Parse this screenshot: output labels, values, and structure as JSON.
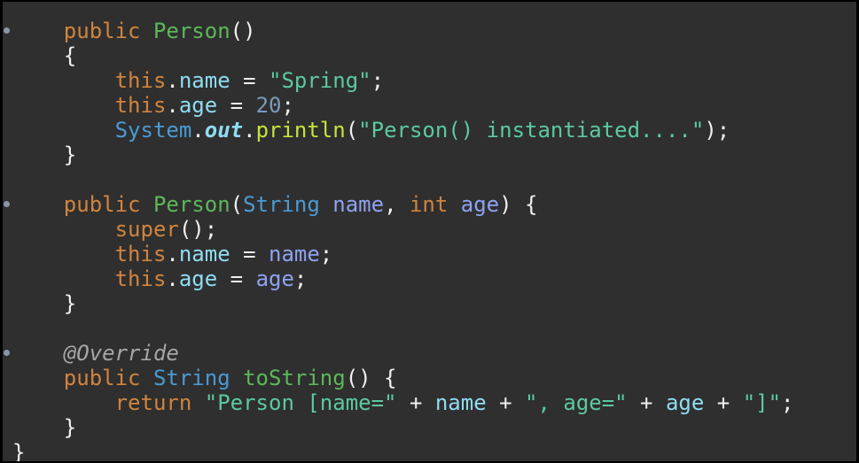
{
  "code": {
    "lines": [
      {
        "fold": true,
        "tokens": [
          [
            "    ",
            "plain"
          ],
          [
            "public",
            "kw"
          ],
          [
            " ",
            "plain"
          ],
          [
            "Person",
            "type"
          ],
          [
            "()",
            "plain"
          ]
        ]
      },
      {
        "tokens": [
          [
            "    {",
            "plain"
          ]
        ]
      },
      {
        "tokens": [
          [
            "        ",
            "plain"
          ],
          [
            "this",
            "kw"
          ],
          [
            ".",
            "plain"
          ],
          [
            "name",
            "field"
          ],
          [
            " = ",
            "plain"
          ],
          [
            "\"Spring\"",
            "str"
          ],
          [
            ";",
            "plain"
          ]
        ]
      },
      {
        "tokens": [
          [
            "        ",
            "plain"
          ],
          [
            "this",
            "kw"
          ],
          [
            ".",
            "plain"
          ],
          [
            "age",
            "field"
          ],
          [
            " = ",
            "plain"
          ],
          [
            "20",
            "num"
          ],
          [
            ";",
            "plain"
          ]
        ]
      },
      {
        "tokens": [
          [
            "        ",
            "plain"
          ],
          [
            "System",
            "cls"
          ],
          [
            ".",
            "plain"
          ],
          [
            "out",
            "static"
          ],
          [
            ".",
            "plain"
          ],
          [
            "println",
            "method"
          ],
          [
            "(",
            "plain"
          ],
          [
            "\"Person() instantiated....\"",
            "str"
          ],
          [
            ");",
            "plain"
          ]
        ]
      },
      {
        "tokens": [
          [
            "    }",
            "plain"
          ]
        ]
      },
      {
        "tokens": []
      },
      {
        "fold": true,
        "tokens": [
          [
            "    ",
            "plain"
          ],
          [
            "public",
            "kw"
          ],
          [
            " ",
            "plain"
          ],
          [
            "Person",
            "type"
          ],
          [
            "(",
            "plain"
          ],
          [
            "String",
            "cls"
          ],
          [
            " ",
            "plain"
          ],
          [
            "name",
            "param"
          ],
          [
            ", ",
            "plain"
          ],
          [
            "int",
            "kw"
          ],
          [
            " ",
            "plain"
          ],
          [
            "age",
            "param"
          ],
          [
            ") {",
            "plain"
          ]
        ]
      },
      {
        "tokens": [
          [
            "        ",
            "plain"
          ],
          [
            "super",
            "kw"
          ],
          [
            "();",
            "plain"
          ]
        ]
      },
      {
        "tokens": [
          [
            "        ",
            "plain"
          ],
          [
            "this",
            "kw"
          ],
          [
            ".",
            "plain"
          ],
          [
            "name",
            "field"
          ],
          [
            " = ",
            "plain"
          ],
          [
            "name",
            "param"
          ],
          [
            ";",
            "plain"
          ]
        ]
      },
      {
        "tokens": [
          [
            "        ",
            "plain"
          ],
          [
            "this",
            "kw"
          ],
          [
            ".",
            "plain"
          ],
          [
            "age",
            "field"
          ],
          [
            " = ",
            "plain"
          ],
          [
            "age",
            "param"
          ],
          [
            ";",
            "plain"
          ]
        ]
      },
      {
        "tokens": [
          [
            "    }",
            "plain"
          ]
        ]
      },
      {
        "tokens": []
      },
      {
        "fold": true,
        "tokens": [
          [
            "    ",
            "plain"
          ],
          [
            "@Override",
            "ann"
          ]
        ]
      },
      {
        "tokens": [
          [
            "    ",
            "plain"
          ],
          [
            "public",
            "kw"
          ],
          [
            " ",
            "plain"
          ],
          [
            "String",
            "cls"
          ],
          [
            " ",
            "plain"
          ],
          [
            "toString",
            "type"
          ],
          [
            "() {",
            "plain"
          ]
        ]
      },
      {
        "tokens": [
          [
            "        ",
            "plain"
          ],
          [
            "return",
            "kw"
          ],
          [
            " ",
            "plain"
          ],
          [
            "\"Person [name=\"",
            "str"
          ],
          [
            " + ",
            "plain"
          ],
          [
            "name",
            "field"
          ],
          [
            " + ",
            "plain"
          ],
          [
            "\", age=\"",
            "str"
          ],
          [
            " + ",
            "plain"
          ],
          [
            "age",
            "field"
          ],
          [
            " + ",
            "plain"
          ],
          [
            "\"]\"",
            "str"
          ],
          [
            ";",
            "plain"
          ]
        ]
      },
      {
        "tokens": [
          [
            "    }",
            "plain"
          ]
        ]
      },
      {
        "tokens": [
          [
            "}",
            "plain"
          ]
        ]
      }
    ]
  }
}
